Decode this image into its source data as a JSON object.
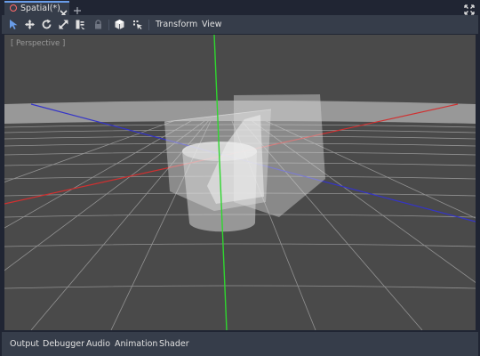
{
  "scene_tabs": {
    "active_tab": "Spatial(*)",
    "icons": {
      "scene": "spatial-node-icon",
      "close": "close-icon",
      "add": "plus-icon",
      "distraction_free": "expand-icon"
    }
  },
  "toolbar": {
    "tools": [
      {
        "name": "select-tool-icon",
        "active": true
      },
      {
        "name": "move-tool-icon",
        "active": false
      },
      {
        "name": "rotate-tool-icon",
        "active": false
      },
      {
        "name": "scale-tool-icon",
        "active": false
      },
      {
        "name": "list-select-icon",
        "active": false
      },
      {
        "name": "lock-icon",
        "active": false
      },
      {
        "name": "local-space-icon",
        "active": false
      },
      {
        "name": "snap-icon",
        "active": false
      }
    ],
    "menus": [
      "Transform",
      "View"
    ]
  },
  "viewport": {
    "label": "[ Perspective ]"
  },
  "bottom_panel": {
    "tabs": [
      "Output",
      "Debugger",
      "Audio",
      "Animation",
      "Shader"
    ]
  },
  "colors": {
    "editor_bg": "#202533",
    "panel_bg": "#363d4a",
    "viewport_bg": "#4a4a4a",
    "accent": "#699ce8",
    "axis_x": "#d03030",
    "axis_y": "#2fd62f",
    "axis_z": "#3434c8"
  }
}
